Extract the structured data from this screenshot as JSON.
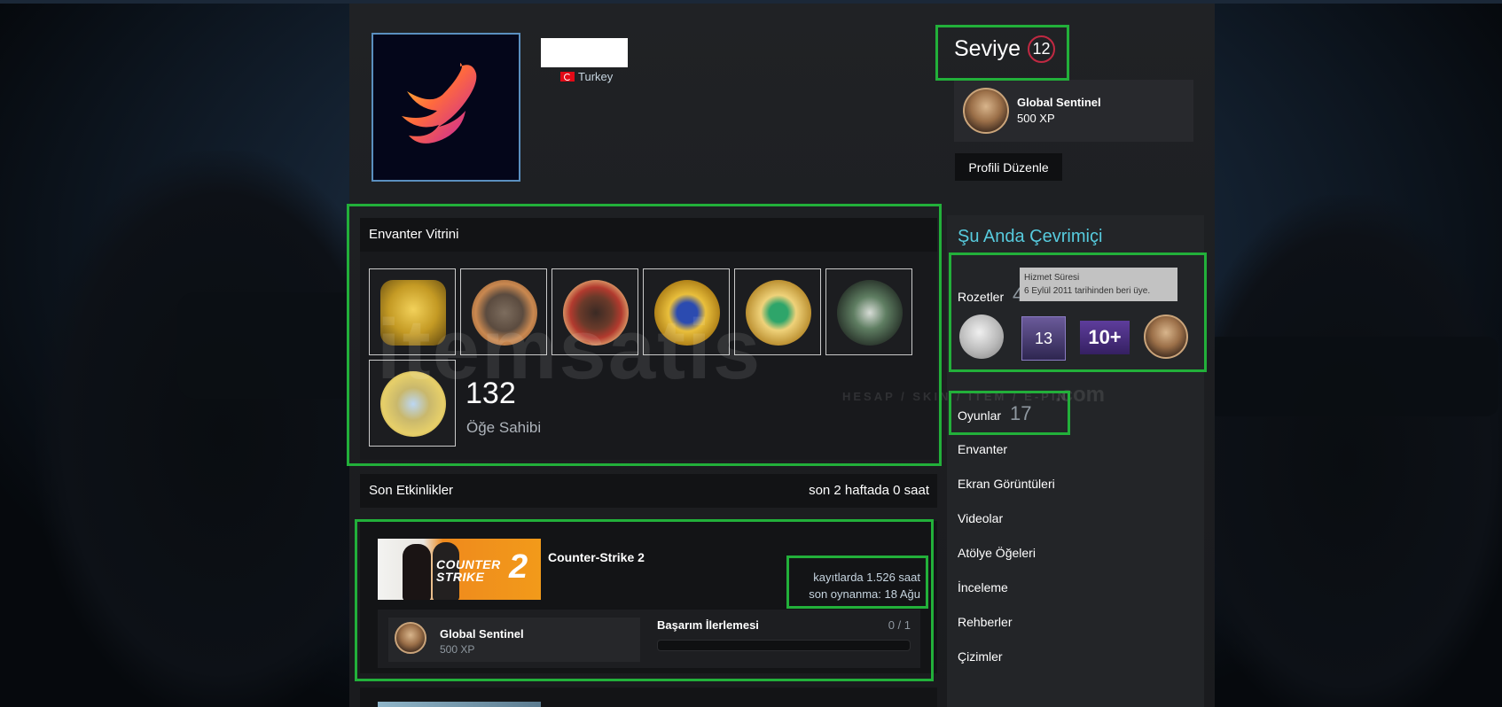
{
  "profile": {
    "country": "Turkey",
    "level_label": "Seviye",
    "level_value": "12",
    "favorite_badge": {
      "name": "Global Sentinel",
      "xp": "500 XP"
    },
    "edit_label": "Profili Düzenle"
  },
  "inventory": {
    "title": "Envanter Vitrini",
    "count": "132",
    "count_label": "Öğe Sahibi",
    "items": [
      "csgo-badge",
      "5-year-coin",
      "10-year-coin",
      "blue-star-coin",
      "gold-star-coin",
      "hydra-coin",
      "gold-coin"
    ]
  },
  "activity": {
    "title": "Son Etkinlikler",
    "summary": "son 2 haftada 0 saat",
    "game": {
      "name": "Counter-Strike 2",
      "logo_line1": "COUNTER",
      "logo_line2": "STRIKE",
      "logo_num": "2",
      "hours": "kayıtlarda 1.526 saat",
      "last_played": "son oynanma: 18 Ağu",
      "achievement_name": "Global Sentinel",
      "achievement_xp": "500 XP",
      "progress_label": "Başarım İlerlemesi",
      "progress_value": "0 / 1",
      "progress_fraction": 0
    }
  },
  "sidebar": {
    "online_status": "Şu Anda Çevrimiçi",
    "badges_label": "Rozetler",
    "badges_count_partial": "4",
    "tooltip_title": "Hizmet Süresi",
    "tooltip_text": "6 Eylül 2011 tarihinden beri üye.",
    "badge_13": "13",
    "badge_10plus": "10+",
    "games_label": "Oyunlar",
    "games_count": "17",
    "links": [
      "Envanter",
      "Ekran Görüntüleri",
      "Videolar",
      "Atölye Öğeleri",
      "İnceleme",
      "Rehberler",
      "Çizimler"
    ]
  },
  "watermark": {
    "brand": "itemsatis",
    "sub": "HESAP / SKIN / ITEM / E-PIN",
    "tld": ".com"
  },
  "colors": {
    "accent_green": "#22b03a",
    "online_blue": "#57cbde",
    "level_red": "#c02942"
  }
}
